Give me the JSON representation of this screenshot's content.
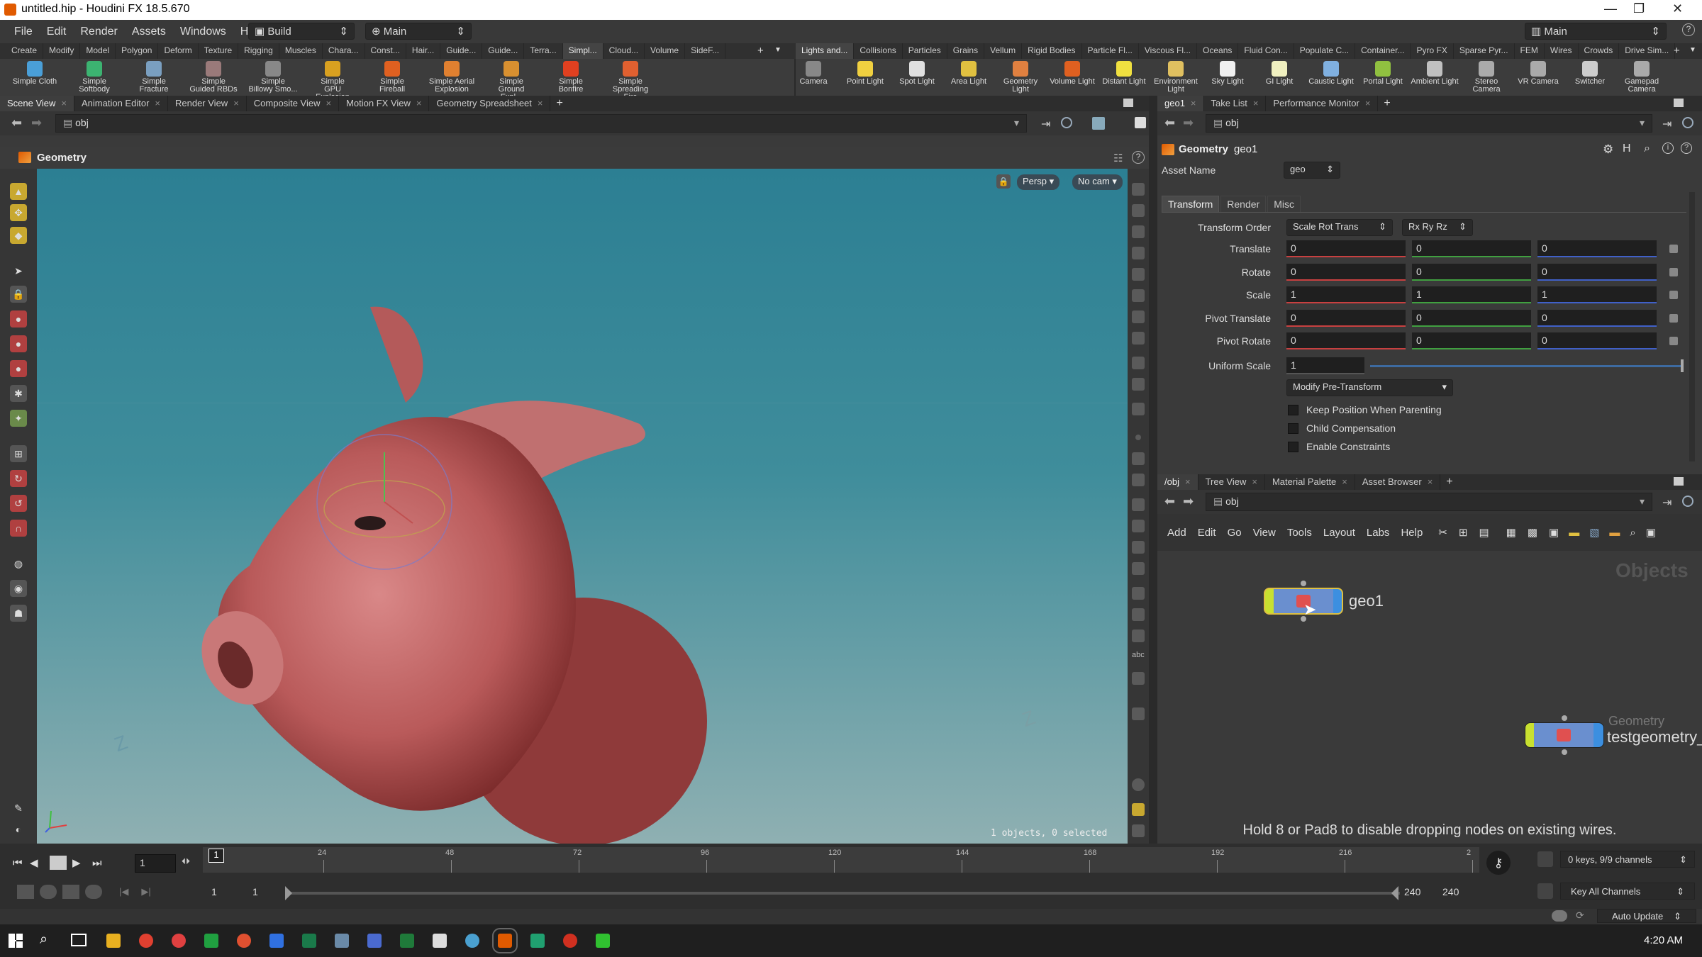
{
  "window": {
    "title": "untitled.hip - Houdini FX 18.5.670"
  },
  "menu": [
    "File",
    "Edit",
    "Render",
    "Assets",
    "Windows",
    "Help"
  ],
  "desktop_dropdown": "Build",
  "main_dropdown": "Main",
  "right_desktop": "Main",
  "shelf_tabs_left": [
    "Create",
    "Modify",
    "Model",
    "Polygon",
    "Deform",
    "Texture",
    "Rigging",
    "Muscles",
    "Chara...",
    "Const...",
    "Hair...",
    "Guide...",
    "Guide...",
    "Terra...",
    "Simpl...",
    "Cloud...",
    "Volume",
    "SideF..."
  ],
  "shelf_tabs_right": [
    "Lights and...",
    "Collisions",
    "Particles",
    "Grains",
    "Vellum",
    "Rigid Bodies",
    "Particle Fl...",
    "Viscous Fl...",
    "Oceans",
    "Fluid Con...",
    "Populate C...",
    "Container...",
    "Pyro FX",
    "Sparse Pyr...",
    "FEM",
    "Wires",
    "Crowds",
    "Drive Sim..."
  ],
  "tools_left": [
    {
      "l1": "Simple Cloth",
      "l2": "",
      "color": "#4a9fd8"
    },
    {
      "l1": "Simple",
      "l2": "Softbody",
      "color": "#3cb371"
    },
    {
      "l1": "Simple",
      "l2": "Fracture",
      "color": "#7a9fc0"
    },
    {
      "l1": "Simple",
      "l2": "Guided RBDs",
      "color": "#9a7a7a"
    },
    {
      "l1": "Simple",
      "l2": "Billowy Smo...",
      "color": "#888888"
    },
    {
      "l1": "Simple",
      "l2": "GPU Explosion",
      "color": "#d8a020"
    },
    {
      "l1": "Simple",
      "l2": "Fireball",
      "color": "#e06020"
    },
    {
      "l1": "Simple Aerial",
      "l2": "Explosion",
      "color": "#e08030"
    },
    {
      "l1": "Simple",
      "l2": "Ground Expl...",
      "color": "#d89030"
    },
    {
      "l1": "Simple",
      "l2": "Bonfire",
      "color": "#e04020"
    },
    {
      "l1": "Simple",
      "l2": "Spreading Fire",
      "color": "#e06030"
    }
  ],
  "tools_right": [
    {
      "l1": "Camera",
      "l2": "",
      "color": "#888888"
    },
    {
      "l1": "Point Light",
      "l2": "",
      "color": "#f0d040"
    },
    {
      "l1": "Spot Light",
      "l2": "",
      "color": "#e0e0e0"
    },
    {
      "l1": "Area Light",
      "l2": "",
      "color": "#e0c040"
    },
    {
      "l1": "Geometry",
      "l2": "Light",
      "color": "#e08040"
    },
    {
      "l1": "Volume Light",
      "l2": "",
      "color": "#e06020"
    },
    {
      "l1": "Distant Light",
      "l2": "",
      "color": "#f0e040"
    },
    {
      "l1": "Environment",
      "l2": "Light",
      "color": "#e0c060"
    },
    {
      "l1": "Sky Light",
      "l2": "",
      "color": "#f0f0f0"
    },
    {
      "l1": "GI Light",
      "l2": "",
      "color": "#f0f0c0"
    },
    {
      "l1": "Caustic Light",
      "l2": "",
      "color": "#80b0e0"
    },
    {
      "l1": "Portal Light",
      "l2": "",
      "color": "#90c040"
    },
    {
      "l1": "Ambient Light",
      "l2": "",
      "color": "#c0c0c0"
    },
    {
      "l1": "Stereo",
      "l2": "Camera",
      "color": "#aaaaaa"
    },
    {
      "l1": "VR Camera",
      "l2": "",
      "color": "#aaaaaa"
    },
    {
      "l1": "Switcher",
      "l2": "",
      "color": "#cccccc"
    },
    {
      "l1": "Gamepad",
      "l2": "Camera",
      "color": "#aaaaaa"
    }
  ],
  "left_panel_tabs": [
    "Scene View",
    "Animation Editor",
    "Render View",
    "Composite View",
    "Motion FX View",
    "Geometry Spreadsheet"
  ],
  "left_path": "obj",
  "viewport": {
    "header": "Geometry",
    "persp": "Persp ▾",
    "cam": "No cam ▾",
    "status": "1 objects, 0 selected"
  },
  "right_top_tabs": [
    "geo1",
    "Take List",
    "Performance Monitor"
  ],
  "right_path": "obj",
  "params": {
    "node_type": "Geometry",
    "node_name": "geo1",
    "asset_name_label": "Asset Name",
    "asset_name_value": "geo",
    "tabs": [
      "Transform",
      "Render",
      "Misc"
    ],
    "transform_order_label": "Transform Order",
    "transform_order": "Scale Rot Trans",
    "rot_order": "Rx Ry Rz",
    "rows": [
      {
        "label": "Translate",
        "x": "0",
        "y": "0",
        "z": "0"
      },
      {
        "label": "Rotate",
        "x": "0",
        "y": "0",
        "z": "0"
      },
      {
        "label": "Scale",
        "x": "1",
        "y": "1",
        "z": "1"
      },
      {
        "label": "Pivot Translate",
        "x": "0",
        "y": "0",
        "z": "0"
      },
      {
        "label": "Pivot Rotate",
        "x": "0",
        "y": "0",
        "z": "0"
      }
    ],
    "uniform_scale_label": "Uniform Scale",
    "uniform_scale": "1",
    "modify_pre": "Modify Pre-Transform",
    "checks": [
      "Keep Position When Parenting",
      "Child Compensation",
      "Enable Constraints"
    ]
  },
  "net_tabs": [
    "/obj",
    "Tree View",
    "Material Palette",
    "Asset Browser"
  ],
  "net_path": "obj",
  "net_menu": [
    "Add",
    "Edit",
    "Go",
    "View",
    "Tools",
    "Layout",
    "Labs",
    "Help"
  ],
  "network": {
    "context_label": "Objects",
    "node1": "geo1",
    "node2_type": "Geometry",
    "node2": "testgeometry_",
    "hint": "Hold 8 or Pad8 to disable dropping nodes on existing wires."
  },
  "timeline": {
    "frame": "1",
    "ticks": [
      "24",
      "48",
      "72",
      "96",
      "120",
      "144",
      "168",
      "192",
      "216",
      "2"
    ],
    "marker": "1",
    "range_start": "1",
    "range_start2": "1",
    "range_end": "240",
    "range_end2": "240",
    "keys": "0 keys, 9/9 channels",
    "key_all": "Key All Channels",
    "auto_update": "Auto Update"
  },
  "taskbar": {
    "time": "4:20 AM"
  }
}
